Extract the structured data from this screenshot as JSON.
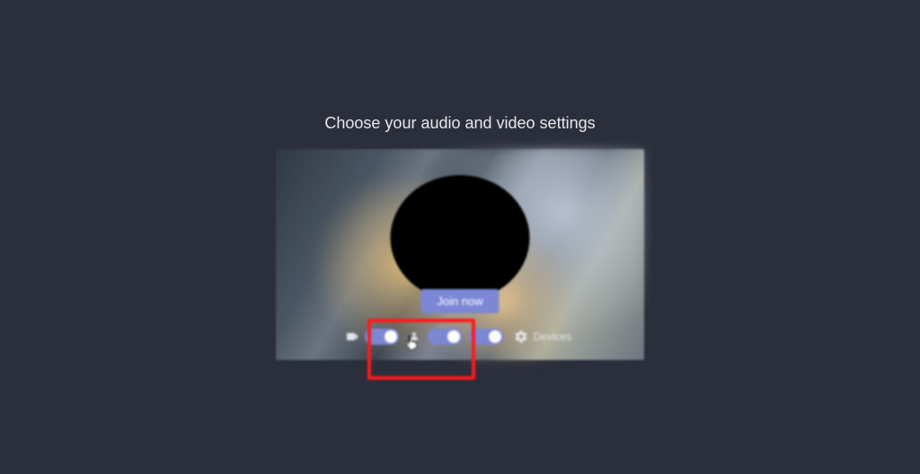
{
  "heading": "Choose your audio and video settings",
  "join_button": {
    "label": "Join now"
  },
  "controls": {
    "camera_toggle": {
      "state": "on"
    },
    "blur_toggle": {
      "state": "on"
    },
    "mic_toggle": {
      "state": "on"
    },
    "devices_label": "Devices"
  },
  "icons": {
    "camera": "camera-icon",
    "blur": "blur-icon",
    "gear": "gear-icon"
  },
  "colors": {
    "accent": "#7c87d5",
    "background": "#2b2e3b",
    "annotation": "#ff1a1a"
  }
}
